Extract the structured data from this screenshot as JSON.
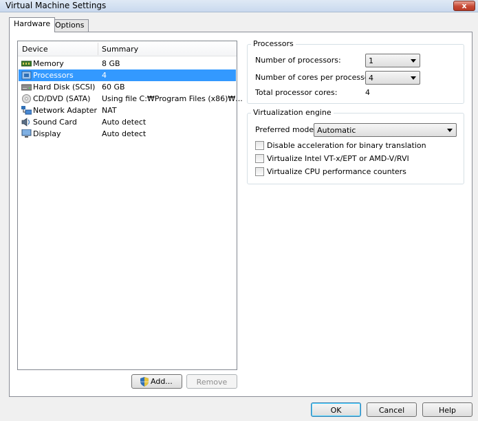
{
  "window": {
    "title": "Virtual Machine Settings",
    "close_glyph": "x"
  },
  "tabs": [
    {
      "label": "Hardware",
      "active": true
    },
    {
      "label": "Options",
      "active": false
    }
  ],
  "device_list": {
    "columns": [
      "Device",
      "Summary"
    ],
    "rows": [
      {
        "icon": "memory-icon",
        "device": "Memory",
        "summary": "8 GB",
        "selected": false
      },
      {
        "icon": "processor-icon",
        "device": "Processors",
        "summary": "4",
        "selected": true
      },
      {
        "icon": "hard-disk-icon",
        "device": "Hard Disk (SCSI)",
        "summary": "60 GB",
        "selected": false
      },
      {
        "icon": "cd-dvd-icon",
        "device": "CD/DVD (SATA)",
        "summary": "Using file C:₩Program Files (x86)₩...",
        "selected": false
      },
      {
        "icon": "network-adapter-icon",
        "device": "Network Adapter",
        "summary": "NAT",
        "selected": false
      },
      {
        "icon": "sound-card-icon",
        "device": "Sound Card",
        "summary": "Auto detect",
        "selected": false
      },
      {
        "icon": "display-icon",
        "device": "Display",
        "summary": "Auto detect",
        "selected": false
      }
    ],
    "add_label": "Add...",
    "remove_label": "Remove"
  },
  "processors": {
    "group_label": "Processors",
    "num_processors_label": "Number of processors:",
    "num_processors_value": "1",
    "cores_label": "Number of cores per processor:",
    "cores_value": "4",
    "total_label": "Total processor cores:",
    "total_value": "4"
  },
  "virtualization": {
    "group_label": "Virtualization engine",
    "mode_label": "Preferred mode:",
    "mode_value": "Automatic",
    "options": [
      {
        "label": "Disable acceleration for binary translation",
        "checked": false
      },
      {
        "label": "Virtualize Intel VT-x/EPT or AMD-V/RVI",
        "checked": false
      },
      {
        "label": "Virtualize CPU performance counters",
        "checked": false
      }
    ]
  },
  "footer": {
    "ok_label": "OK",
    "cancel_label": "Cancel",
    "help_label": "Help"
  },
  "colors": {
    "selection": "#3399ff",
    "close_button": "#c74a36"
  }
}
